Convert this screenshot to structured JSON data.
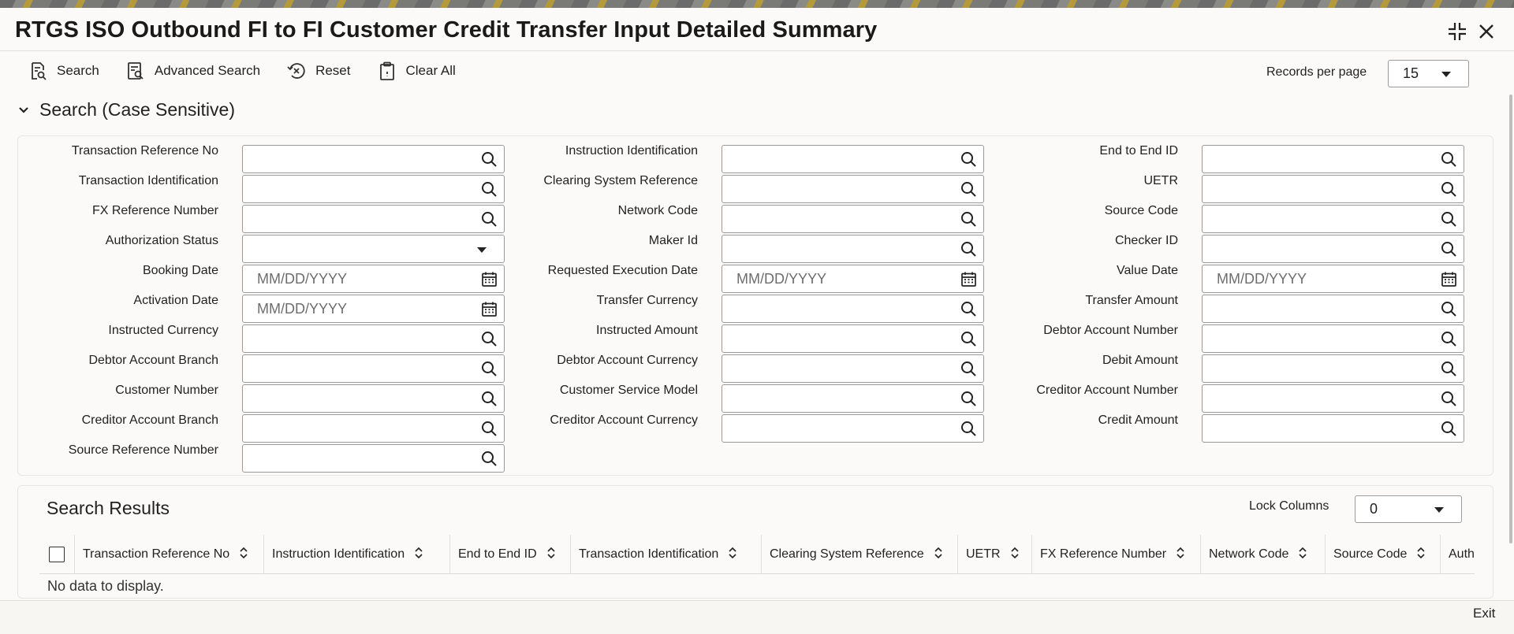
{
  "window": {
    "title": "RTGS ISO Outbound FI to FI Customer Credit Transfer Input Detailed Summary",
    "controls": [
      "collapse-icon",
      "close-icon"
    ]
  },
  "toolbar": {
    "search_label": "Search",
    "advanced_search_label": "Advanced Search",
    "reset_label": "Reset",
    "clear_all_label": "Clear All"
  },
  "records_per_page": {
    "label": "Records per page",
    "value": "15"
  },
  "search_section": {
    "title": "Search (Case Sensitive)",
    "fields": [
      {
        "label": "Transaction Reference No",
        "type": "lookup",
        "value": ""
      },
      {
        "label": "Instruction Identification",
        "type": "lookup",
        "value": ""
      },
      {
        "label": "End to End ID",
        "type": "lookup",
        "value": ""
      },
      {
        "label": "Transaction Identification",
        "type": "lookup",
        "value": ""
      },
      {
        "label": "Clearing System Reference",
        "type": "lookup",
        "value": ""
      },
      {
        "label": "UETR",
        "type": "lookup",
        "value": ""
      },
      {
        "label": "FX Reference Number",
        "type": "lookup",
        "value": ""
      },
      {
        "label": "Network Code",
        "type": "lookup",
        "value": ""
      },
      {
        "label": "Source Code",
        "type": "lookup",
        "value": ""
      },
      {
        "label": "Authorization Status",
        "type": "select",
        "value": ""
      },
      {
        "label": "Maker Id",
        "type": "lookup",
        "value": ""
      },
      {
        "label": "Checker ID",
        "type": "lookup",
        "value": ""
      },
      {
        "label": "Booking Date",
        "type": "date",
        "placeholder": "MM/DD/YYYY"
      },
      {
        "label": "Requested Execution Date",
        "type": "date",
        "placeholder": "MM/DD/YYYY"
      },
      {
        "label": "Value Date",
        "type": "date",
        "placeholder": "MM/DD/YYYY"
      },
      {
        "label": "Activation Date",
        "type": "date",
        "placeholder": "MM/DD/YYYY"
      },
      {
        "label": "Transfer Currency",
        "type": "lookup",
        "value": ""
      },
      {
        "label": "Transfer Amount",
        "type": "lookup",
        "value": ""
      },
      {
        "label": "Instructed Currency",
        "type": "lookup",
        "value": ""
      },
      {
        "label": "Instructed Amount",
        "type": "lookup",
        "value": ""
      },
      {
        "label": "Debtor Account Number",
        "type": "lookup",
        "value": ""
      },
      {
        "label": "Debtor Account Branch",
        "type": "lookup",
        "value": ""
      },
      {
        "label": "Debtor Account Currency",
        "type": "lookup",
        "value": ""
      },
      {
        "label": "Debit Amount",
        "type": "lookup",
        "value": ""
      },
      {
        "label": "Customer Number",
        "type": "lookup",
        "value": ""
      },
      {
        "label": "Customer Service Model",
        "type": "lookup",
        "value": ""
      },
      {
        "label": "Creditor Account Number",
        "type": "lookup",
        "value": ""
      },
      {
        "label": "Creditor Account Branch",
        "type": "lookup",
        "value": ""
      },
      {
        "label": "Creditor Account Currency",
        "type": "lookup",
        "value": ""
      },
      {
        "label": "Credit Amount",
        "type": "lookup",
        "value": ""
      },
      {
        "label": "Source Reference Number",
        "type": "lookup",
        "value": ""
      }
    ]
  },
  "results": {
    "title": "Search Results",
    "lock_columns": {
      "label": "Lock Columns",
      "value": "0"
    },
    "columns": [
      "Transaction Reference No",
      "Instruction Identification",
      "End to End ID",
      "Transaction Identification",
      "Clearing System Reference",
      "UETR",
      "FX Reference Number",
      "Network Code",
      "Source Code",
      "Auth"
    ],
    "empty_message": "No data to display."
  },
  "footer": {
    "exit_label": "Exit"
  }
}
